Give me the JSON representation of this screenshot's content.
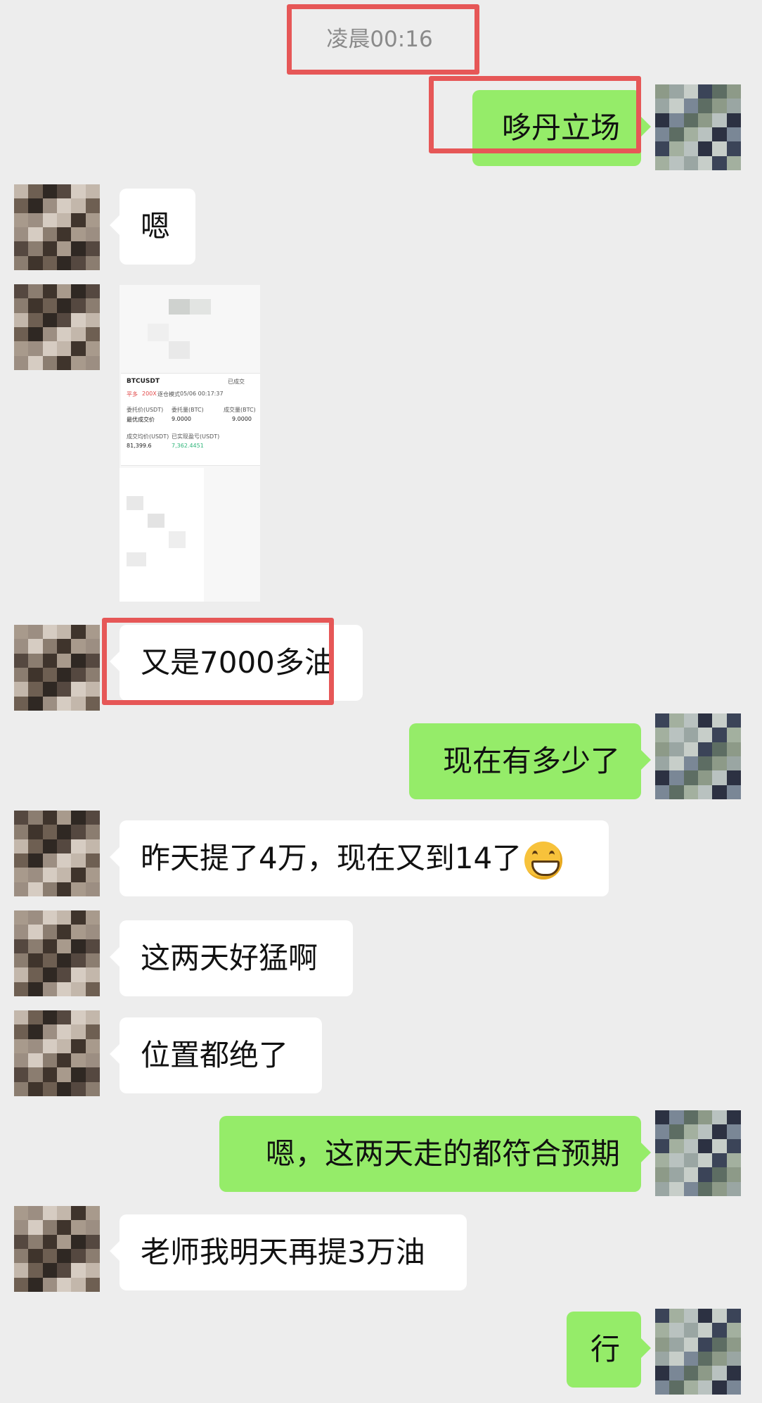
{
  "chat": {
    "timestamp": "凌晨00:16",
    "messages": [
      {
        "side": "out",
        "text": "哆丹立场"
      },
      {
        "side": "in",
        "text": "嗯"
      },
      {
        "side": "in",
        "type": "image"
      },
      {
        "side": "in",
        "text": "又是7000多油"
      },
      {
        "side": "out",
        "text": "现在有多少了"
      },
      {
        "side": "in",
        "text": "昨天提了4万，现在又到14了",
        "emoji": "grinning-face"
      },
      {
        "side": "in",
        "text": "这两天好猛啊"
      },
      {
        "side": "in",
        "text": "位置都绝了"
      },
      {
        "side": "out",
        "text": "嗯，这两天走的都符合预期"
      },
      {
        "side": "in",
        "text": "老师我明天再提3万油"
      },
      {
        "side": "out",
        "text": "行"
      }
    ]
  },
  "screenshot_card": {
    "pair": "BTCUSDT",
    "status": "已成交",
    "tag_side": "平多",
    "tag_leverage": "200X",
    "tag_mode": "逐仓模式",
    "time": "05/06 00:17:37",
    "col1_label": "委托价(USDT)",
    "col1_value": "最优成交价",
    "col2_label": "委托量(BTC)",
    "col2_value": "9.0000",
    "col3_label": "成交量(BTC)",
    "col3_value": "9.0000",
    "row2_label1": "成交均价(USDT)",
    "row2_value1": "81,399.6",
    "row2_label2": "已实现盈亏(USDT)",
    "row2_value2": "7,362.4451"
  },
  "colors": {
    "background": "#ededed",
    "outgoing_bubble": "#95ec69",
    "incoming_bubble": "#ffffff",
    "highlight_box": "#e65757",
    "timestamp_text": "#8a8a8a"
  }
}
